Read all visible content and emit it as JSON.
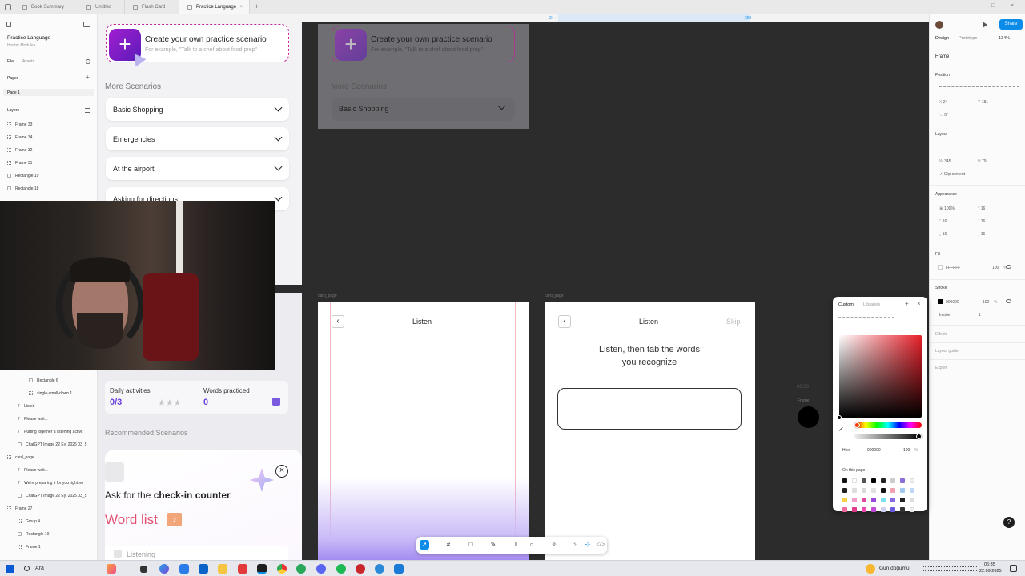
{
  "tabs": [
    {
      "label": "Book Summary",
      "active": false
    },
    {
      "label": "Untitled",
      "active": false
    },
    {
      "label": "Flash Card",
      "active": false
    },
    {
      "label": "Practice Language",
      "active": true
    }
  ],
  "left_panel": {
    "project_name": "Practice Language",
    "project_sub": "Hunter Modules",
    "tab_file": "File",
    "tab_assets": "Assets",
    "pages_label": "Pages",
    "page_1": "Page 1",
    "layers_label": "Layers",
    "layers_top": [
      "Frame 33",
      "Frame 34",
      "Frame 32",
      "Frame 31",
      "Rectangle 19",
      "Rectangle 18"
    ],
    "layers_bottom": [
      {
        "label": "Rectangle 6",
        "indent": 2,
        "icon": "rect"
      },
      {
        "label": "single-small-down 1",
        "indent": 2,
        "icon": "frame"
      },
      {
        "label": "Listen",
        "indent": 1,
        "icon": "txt"
      },
      {
        "label": "Please wait...",
        "indent": 1,
        "icon": "txt"
      },
      {
        "label": "Putting together a listening activit",
        "indent": 1,
        "icon": "txt"
      },
      {
        "label": "ChatGPT Image 22 Eyl 2025 03_5",
        "indent": 1,
        "icon": "rect"
      },
      {
        "label": "card_page",
        "indent": 0,
        "icon": "frame"
      },
      {
        "label": "Please wait...",
        "indent": 1,
        "icon": "txt"
      },
      {
        "label": "We're preparing it for you right no",
        "indent": 1,
        "icon": "txt"
      },
      {
        "label": "ChatGPT Image 22 Eyl 2025 03_5",
        "indent": 1,
        "icon": "rect"
      },
      {
        "label": "Frame 27",
        "indent": 0,
        "icon": "frame"
      },
      {
        "label": "Group 4",
        "indent": 1,
        "icon": "frame"
      },
      {
        "label": "Rectangle 10",
        "indent": 1,
        "icon": "rect"
      },
      {
        "label": "Frame 1",
        "indent": 1,
        "icon": "frame"
      }
    ]
  },
  "canvas": {
    "ruler_marks": [
      "24",
      "369"
    ],
    "create_title": "Create your own practice scenario",
    "create_subtitle": "For example, \"Talk to a chef about food prep\"",
    "more_scenarios": "More Scenarios",
    "scenarios": [
      "Basic Shopping",
      "Emergencies",
      "At the airport",
      "Asking for directions"
    ],
    "preview_more_scenarios": "More Scenarios",
    "preview_first_scenario": "Basic Shopping",
    "frame_label_1": "card_page",
    "frame_label_2": "card_page",
    "daily_activities": "Daily activities",
    "daily_value": "0/3",
    "words_practiced": "Words practiced",
    "words_value": "0",
    "recommended": "Recommended Scenarios",
    "ask_prefix": "Ask for the ",
    "ask_bold": "check-in counter",
    "word_list": "Word list",
    "listening": "Listening",
    "listen_title_1": "Listen",
    "listen_title_2": "Listen",
    "skip": "Skip",
    "instruction": "Listen, then tab the words you recognize",
    "frame_small_label": "Frame",
    "small_readout": "00:00"
  },
  "right_panel": {
    "tab_design": "Design",
    "tab_prototype": "Prototype",
    "zoom": "134%",
    "share": "Share",
    "frame_label": "Frame",
    "position_label": "Position",
    "x_value": "24",
    "y_value": "181",
    "rotation": "0°",
    "layout_label": "Layout",
    "w_value": "345",
    "h_value": "79",
    "clip_content": "Clip content",
    "appearance_label": "Appearance",
    "opacity": "100%",
    "radius_1": "16",
    "radius_2": "16",
    "radius_3": "16",
    "radius_4": "16",
    "radius_5": "16",
    "fill_label": "Fill",
    "fill_hex": "FFFFFF",
    "fill_opacity": "100",
    "pct": "%",
    "stroke_label": "Stroke",
    "stroke_hex": "000000",
    "stroke_opacity": "100",
    "stroke_position": "Inside",
    "stroke_width": "1",
    "effects_label": "Effects",
    "layout_guide_label": "Layout guide",
    "export_label": "Export"
  },
  "picker": {
    "tab_custom": "Custom",
    "tab_libraries": "Libraries",
    "mode": "Hex",
    "hex": "000000",
    "opacity": "100",
    "pct": "%",
    "on_this_page": "On this page",
    "swatches": [
      "#111111",
      "#ffffff",
      "#555555",
      "#000000",
      "#222222",
      "#cccccc",
      "#8b6fd6",
      "#eeeeee",
      "#222222",
      "#dddddd",
      "#d8d8d8",
      "#e0e0e0",
      "#111111",
      "#f0a0b0",
      "#a0c8f0",
      "#c0d8f8",
      "#f5d24a",
      "#f0a0c8",
      "#e04a9a",
      "#9a4ad8",
      "#7de0f0",
      "#8a6ae0",
      "#222222",
      "#dddddd",
      "#f06aa0",
      "#e03a8a",
      "#f04ab0",
      "#c04ad8",
      "#d0d0f0",
      "#6a5ae0",
      "#333333",
      "#eeeeee"
    ]
  },
  "taskbar": {
    "search": "Ara",
    "weather": "Gün doğumu",
    "time": "06:35",
    "date": "22.09.2025"
  },
  "colors": {
    "accent": "#0c8ce9",
    "brand_purple": "#7b2bd6",
    "dashed_pink": "#c2239b"
  }
}
